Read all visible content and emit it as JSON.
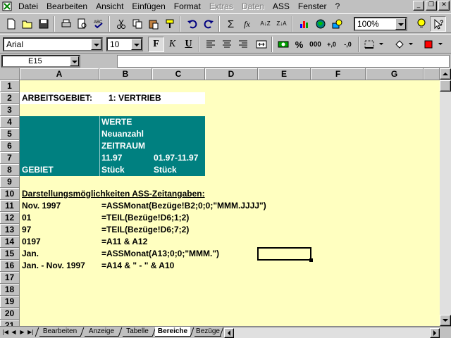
{
  "menubar": {
    "items": [
      {
        "label": "Datei",
        "disabled": false
      },
      {
        "label": "Bearbeiten",
        "disabled": false
      },
      {
        "label": "Ansicht",
        "disabled": false
      },
      {
        "label": "Einfügen",
        "disabled": false
      },
      {
        "label": "Format",
        "disabled": false
      },
      {
        "label": "Extras",
        "disabled": true
      },
      {
        "label": "Daten",
        "disabled": true
      },
      {
        "label": "ASS",
        "disabled": false
      },
      {
        "label": "Fenster",
        "disabled": false
      },
      {
        "label": "?",
        "disabled": false
      }
    ],
    "window_buttons": {
      "minimize": "_",
      "restore": "❐",
      "close": "✕"
    }
  },
  "toolbar1": {
    "zoom": "100%",
    "icons": [
      "new-icon",
      "open-icon",
      "save-icon",
      "print-icon",
      "print-preview-icon",
      "spellcheck-icon",
      "cut-icon",
      "copy-icon",
      "paste-icon",
      "format-painter-icon",
      "undo-icon",
      "redo-icon",
      "autosum-icon",
      "function-wizard-icon",
      "sort-ascending-icon",
      "sort-descending-icon",
      "chart-wizard-icon",
      "map-icon",
      "drawing-icon",
      "tip-wizard-icon",
      "help-icon"
    ],
    "glyphs": {
      "sum": "Σ",
      "fx": "fx",
      "az": "A↓Z",
      "za": "Z↓A"
    }
  },
  "toolbar2": {
    "font": "Arial",
    "size": "10",
    "bold": "F",
    "italic": "K",
    "underline": "U",
    "percent": "%",
    "thousands": "000",
    "inc_decimal": "+,0",
    "dec_decimal": "-,0"
  },
  "formulabar": {
    "namebox": "E15",
    "content": ""
  },
  "colors": {
    "cell_background": "#ffffc0",
    "header_block": "#008080",
    "header_text": "#ffffff"
  },
  "grid": {
    "columns": [
      "A",
      "B",
      "C",
      "D",
      "E",
      "F",
      "G"
    ],
    "rows": [
      "1",
      "2",
      "3",
      "4",
      "5",
      "6",
      "7",
      "8",
      "9",
      "10",
      "11",
      "12",
      "13",
      "14",
      "15",
      "16",
      "17",
      "18",
      "19",
      "20",
      "21"
    ],
    "cells": {
      "a2": "ARBEITSGEBIET:",
      "b2": "1: VERTRIEB",
      "b4": "WERTE",
      "b5": "Neuanzahl",
      "b6": "ZEITRAUM",
      "b7": "11.97",
      "c7": "01.97-11.97",
      "a8": "GEBIET",
      "b8": "Stück",
      "c8": "Stück",
      "a10": "Darstellungsmöglichkeiten ASS-Zeitangaben:",
      "a11": "Nov. 1997",
      "b11": "=ASSMonat(Bezüge!B2;0;0;\"MMM.JJJJ\")",
      "a12": "01",
      "b12": "=TEIL(Bezüge!D6;1;2)",
      "a13": "97",
      "b13": "=TEIL(Bezüge!D6;7;2)",
      "a14": "0197",
      "b14": "=A11 & A12",
      "a15": "Jan.",
      "b15": "=ASSMonat(A13;0;0;\"MMM.\")",
      "a16": "Jan. - Nov. 1997",
      "b16": "=A14 & \" - \" & A10"
    }
  },
  "sheets": {
    "tabs": [
      "Bearbeiten",
      "Anzeige",
      "Tabelle",
      "Bereiche",
      "Bezüge"
    ],
    "active": "Bereiche"
  }
}
